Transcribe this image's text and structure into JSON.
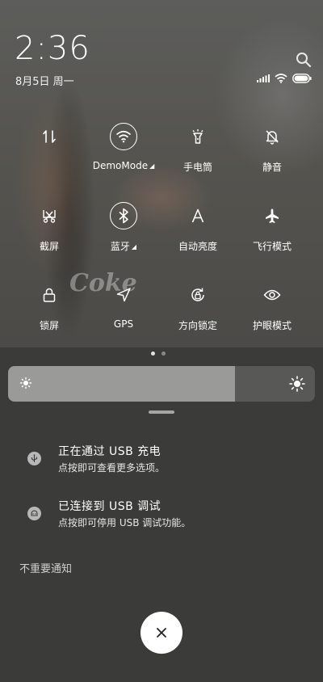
{
  "status": {
    "time": "2:36",
    "date": "8月5日 周一"
  },
  "tiles": [
    {
      "name": "tile-mobile-data",
      "icon": "data-transfer-icon",
      "label": "",
      "active": false
    },
    {
      "name": "tile-wifi",
      "icon": "wifi-icon",
      "label": "DemoMode",
      "active": true,
      "has_menu": true
    },
    {
      "name": "tile-flashlight",
      "icon": "flashlight-icon",
      "label": "手电筒",
      "active": false
    },
    {
      "name": "tile-mute",
      "icon": "bell-off-icon",
      "label": "静音",
      "active": false
    },
    {
      "name": "tile-screenshot",
      "icon": "scissors-icon",
      "label": "截屏",
      "active": false
    },
    {
      "name": "tile-bluetooth",
      "icon": "bluetooth-icon",
      "label": "蓝牙",
      "active": true,
      "has_menu": true
    },
    {
      "name": "tile-auto-brightness",
      "icon": "auto-brightness-icon",
      "label": "自动亮度",
      "active": false
    },
    {
      "name": "tile-airplane",
      "icon": "airplane-icon",
      "label": "飞行模式",
      "active": false
    },
    {
      "name": "tile-lock-screen",
      "icon": "lock-icon",
      "label": "锁屏",
      "active": false
    },
    {
      "name": "tile-gps",
      "icon": "location-arrow-icon",
      "label": "GPS",
      "active": false
    },
    {
      "name": "tile-rotation-lock",
      "icon": "rotation-lock-icon",
      "label": "方向锁定",
      "active": false
    },
    {
      "name": "tile-eye-care",
      "icon": "eye-icon",
      "label": "护眼模式",
      "active": false
    }
  ],
  "brightness": {
    "level_percent": 74
  },
  "notifications": [
    {
      "icon": "usb-icon",
      "title": "正在通过 USB 充电",
      "subtitle": "点按即可查看更多选项。"
    },
    {
      "icon": "android-debug-icon",
      "title": "已连接到 USB 调试",
      "subtitle": "点按即可停用 USB 调试功能。"
    }
  ],
  "section": {
    "unimportant_label": "不重要通知"
  },
  "colors": {
    "accent": "#ffffff",
    "panel_bg": "#3b3b39",
    "slider_fill": "#9a9a98"
  }
}
